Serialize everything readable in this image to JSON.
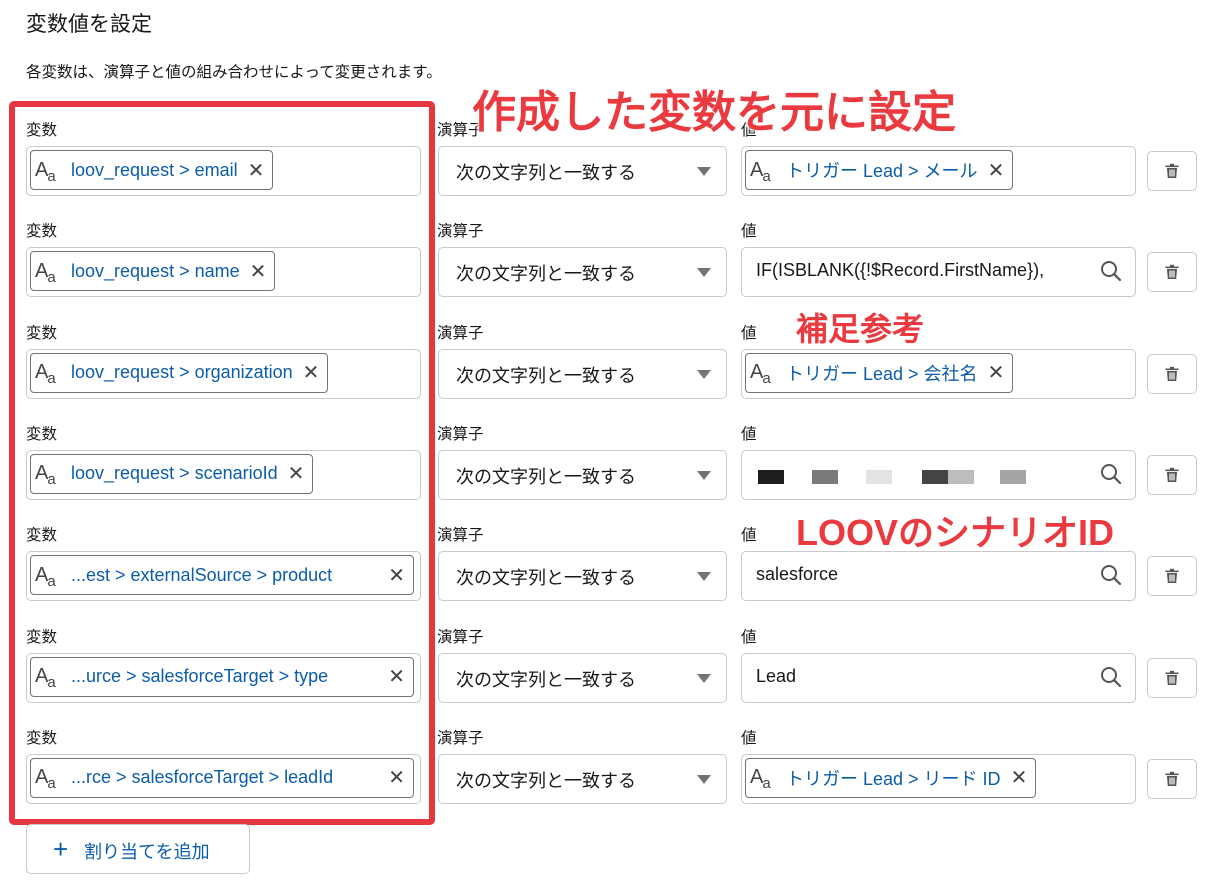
{
  "header": {
    "title": "変数値を設定",
    "description": "各変数は、演算子と値の組み合わせによって変更されます。"
  },
  "labels": {
    "variable": "変数",
    "operator": "演算子",
    "value": "値"
  },
  "rows": [
    {
      "variable": "loov_request > email",
      "operator": "次の文字列と一致する",
      "value_type": "pill",
      "value": "トリガー Lead > メール"
    },
    {
      "variable": "loov_request > name",
      "operator": "次の文字列と一致する",
      "value_type": "text",
      "value": "IF(ISBLANK({!$Record.FirstName}),"
    },
    {
      "variable": "loov_request > organization",
      "operator": "次の文字列と一致する",
      "value_type": "pill",
      "value": "トリガー Lead > 会社名"
    },
    {
      "variable": "loov_request > scenarioId",
      "operator": "次の文字列と一致する",
      "value_type": "redacted",
      "value": ""
    },
    {
      "variable": "...est > externalSource > product",
      "operator": "次の文字列と一致する",
      "value_type": "text",
      "value": "salesforce"
    },
    {
      "variable": "...urce > salesforceTarget > type",
      "operator": "次の文字列と一致する",
      "value_type": "text",
      "value": "Lead"
    },
    {
      "variable": "...rce > salesforceTarget > leadId",
      "operator": "次の文字列と一致する",
      "value_type": "pill",
      "value": "トリガー Lead > リード ID"
    }
  ],
  "annotations": {
    "top": "作成した変数を元に設定",
    "supplement": "補足参考",
    "scenario": "LOOVのシナリオID"
  },
  "add_button": {
    "plus": "+",
    "label": "割り当てを追加"
  },
  "icons": {
    "text_type": "Aa-text-type-icon",
    "remove": "close-icon",
    "search": "search-icon",
    "delete": "trash-icon",
    "dropdown": "chevron-down-icon"
  },
  "colors": {
    "link_blue": "#0b5cab",
    "annotation_red": "#e6363f"
  }
}
